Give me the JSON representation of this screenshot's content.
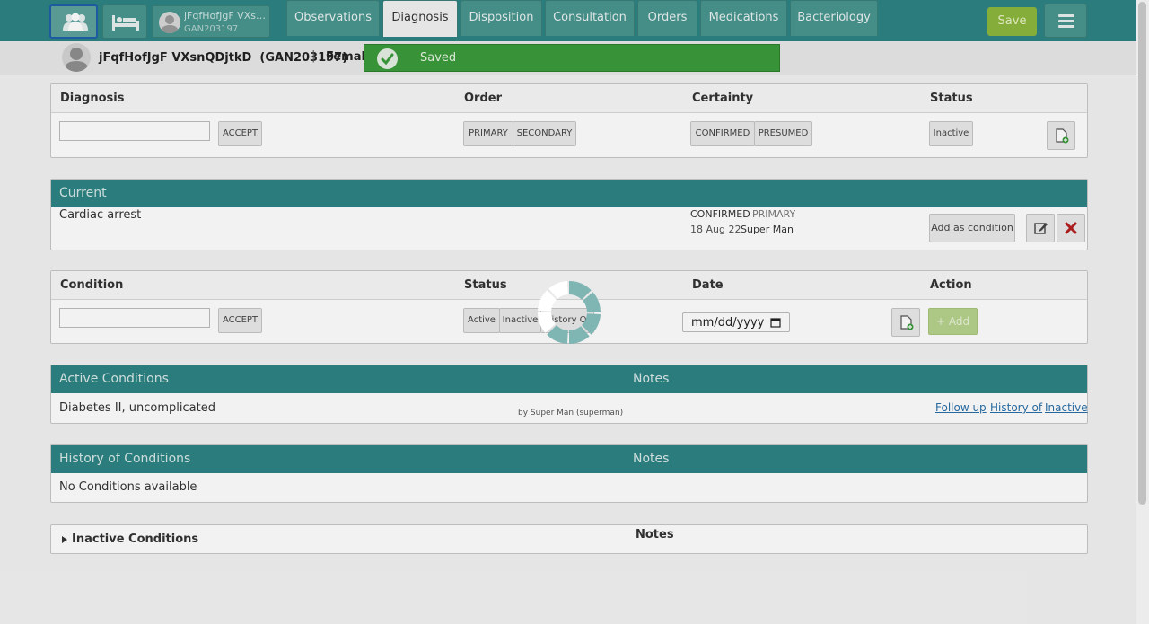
{
  "patient_chip": {
    "name": "jFqfHofJgF VXsn...",
    "id": "GAN203197"
  },
  "tabs": [
    {
      "label": "Observations",
      "active": false
    },
    {
      "label": "Diagnosis",
      "active": true
    },
    {
      "label": "Disposition",
      "active": false
    },
    {
      "label": "Consultation",
      "active": false
    },
    {
      "label": "Orders",
      "active": false
    },
    {
      "label": "Medications",
      "active": false
    },
    {
      "label": "Bacteriology",
      "active": false
    }
  ],
  "save_label": "Save",
  "patient": {
    "name": "jFqfHofJgF VXsnQDjtkD",
    "id": "(GAN203197)",
    "separator": "|",
    "gender": "Female"
  },
  "toast": {
    "text": "Saved"
  },
  "diagnosis_panel": {
    "headers": {
      "diagnosis": "Diagnosis",
      "order": "Order",
      "certainty": "Certainty",
      "status": "Status"
    },
    "accept_label": "ACCEPT",
    "order_options": [
      "PRIMARY",
      "SECONDARY"
    ],
    "certainty_options": [
      "CONFIRMED",
      "PRESUMED"
    ],
    "status_option": "Inactive"
  },
  "current": {
    "title": "Current",
    "diagnosis": "Cardiac arrest",
    "certainty": "CONFIRMED",
    "order": "PRIMARY",
    "date": "18 Aug 22",
    "author": "Super Man",
    "add_condition_label": "Add as condition"
  },
  "condition_panel": {
    "headers": {
      "condition": "Condition",
      "status": "Status",
      "date": "Date",
      "action": "Action"
    },
    "accept_label": "ACCEPT",
    "status_options": [
      "Active",
      "Inactive",
      "History Of"
    ],
    "date_placeholder": "mm/dd/yyyy",
    "add_label": "Add"
  },
  "active_conditions": {
    "title": "Active Conditions",
    "notes_label": "Notes",
    "row": {
      "name": "Diabetes II, uncomplicated",
      "by": "by Super Man (superman)",
      "links": [
        "Follow up",
        "History of",
        "Inactive"
      ]
    }
  },
  "history_conditions": {
    "title": "History of Conditions",
    "notes_label": "Notes",
    "empty": "No Conditions available"
  },
  "inactive_conditions": {
    "title": "Inactive Conditions",
    "notes_label": "Notes"
  },
  "colors": {
    "teal": "#2e8384",
    "save_green": "#8db73d",
    "toast_green": "#3c9a3a",
    "link_blue": "#2a6fa8"
  }
}
